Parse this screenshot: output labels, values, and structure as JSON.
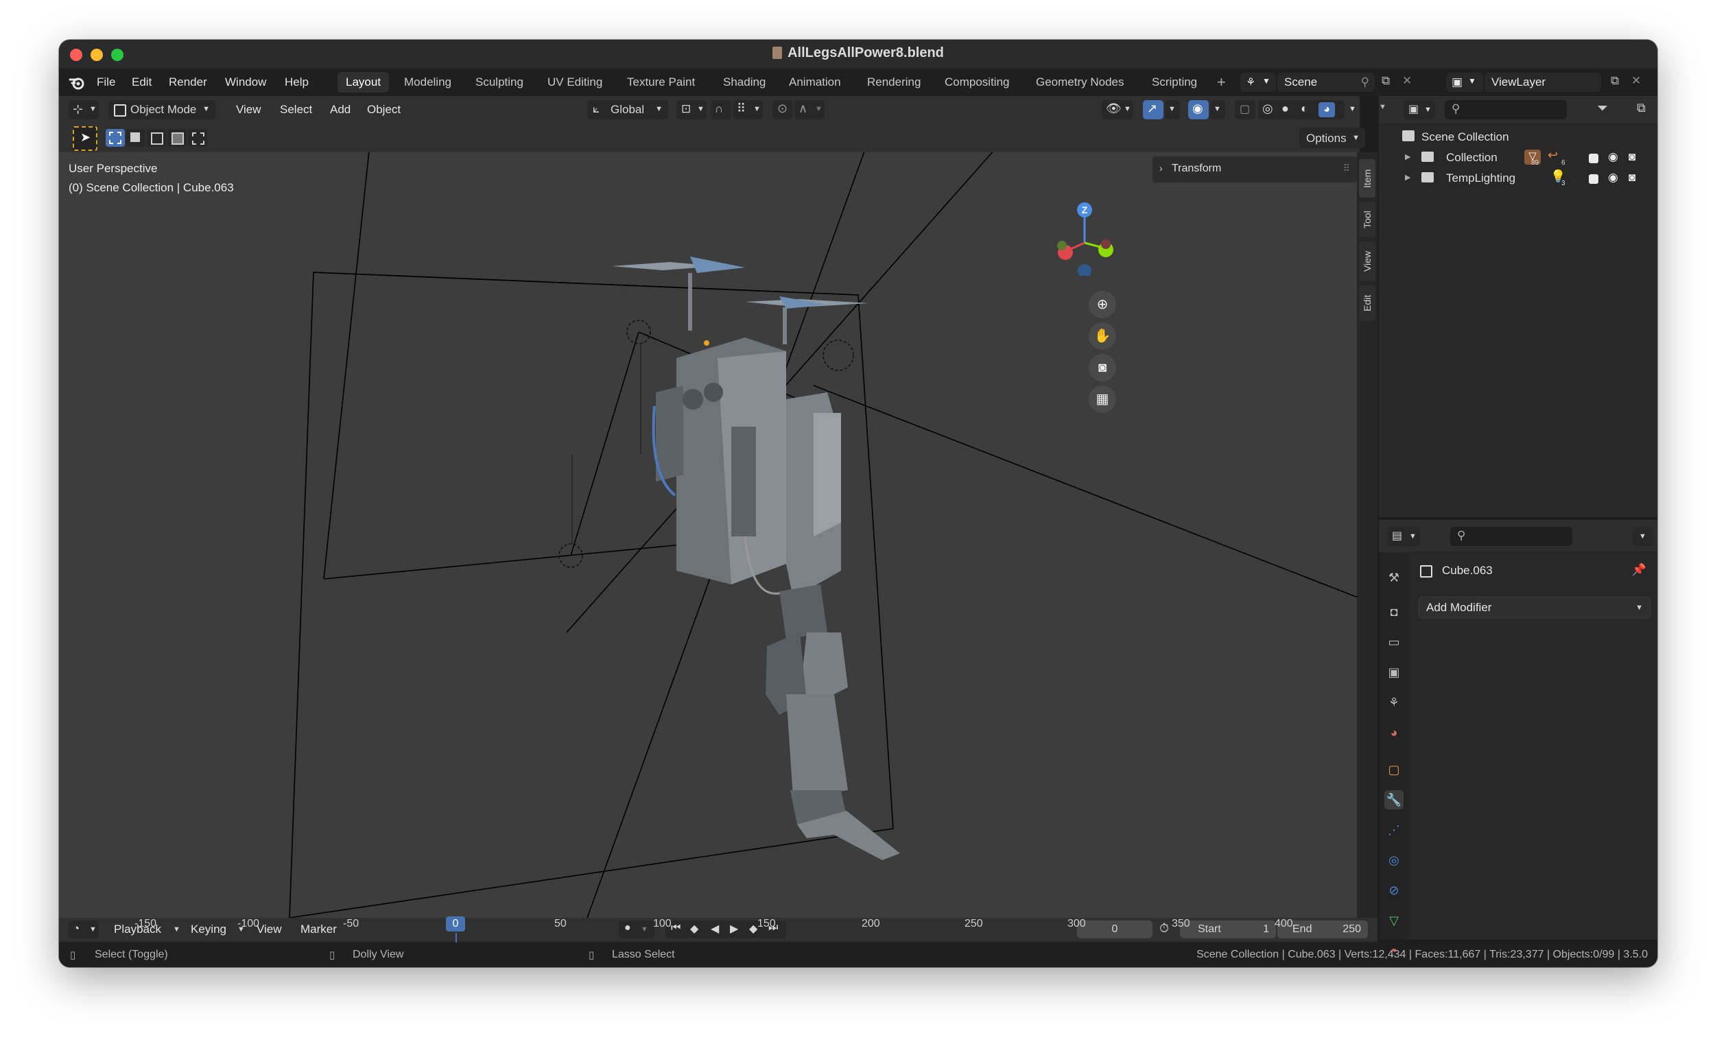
{
  "window": {
    "title": "AllLegsAllPower8.blend",
    "traffic_colors": [
      "#ff5f57",
      "#febc2e",
      "#28c840"
    ]
  },
  "menu": [
    "File",
    "Edit",
    "Render",
    "Window",
    "Help"
  ],
  "workspaces": [
    "Layout",
    "Modeling",
    "Sculpting",
    "UV Editing",
    "Texture Paint",
    "Shading",
    "Animation",
    "Rendering",
    "Compositing",
    "Geometry Nodes",
    "Scripting"
  ],
  "active_workspace": "Layout",
  "scene_field": "Scene",
  "viewlayer_field": "ViewLayer",
  "viewport_header": {
    "mode": "Object Mode",
    "menus": [
      "View",
      "Select",
      "Add",
      "Object"
    ],
    "transform_orientation": "Global",
    "options_label": "Options"
  },
  "viewport": {
    "overlay_line1": "User Perspective",
    "overlay_line2": "(0) Scene Collection | Cube.063",
    "npanel_title": "Transform",
    "side_tabs": [
      "Item",
      "Tool",
      "View",
      "Edit"
    ],
    "gizmo_axis_label": "Z",
    "nav_icons": [
      "zoom-icon",
      "pan-hand-icon",
      "camera-icon",
      "grid-ortho-icon"
    ]
  },
  "timeline": {
    "menus": [
      "Playback",
      "Keying",
      "View",
      "Marker"
    ],
    "current_frame": "0",
    "start_label": "Start",
    "start_value": "1",
    "end_label": "End",
    "end_value": "250",
    "ruler_ticks": [
      "-150",
      "-100",
      "-50",
      "0",
      "50",
      "100",
      "150",
      "200",
      "250",
      "300",
      "350",
      "400"
    ]
  },
  "status_bar": {
    "hint1": "Select (Toggle)",
    "hint2": "Dolly View",
    "hint3": "Lasso Select",
    "stats": "Scene Collection | Cube.063 | Verts:12,434 | Faces:11,667 | Tris:23,377 | Objects:0/99 | 3.5.0"
  },
  "outliner": {
    "root": "Scene Collection",
    "items": [
      {
        "label": "Collection",
        "badge1": "89",
        "badge2": "6"
      },
      {
        "label": "TempLighting",
        "badge1": "3"
      }
    ]
  },
  "properties": {
    "object_name": "Cube.063",
    "add_modifier": "Add Modifier"
  },
  "colors": {
    "accent_blue": "#4772b3",
    "axis_x": "#e0474c",
    "axis_y": "#8bdc00",
    "axis_z": "#4d8fe6"
  }
}
